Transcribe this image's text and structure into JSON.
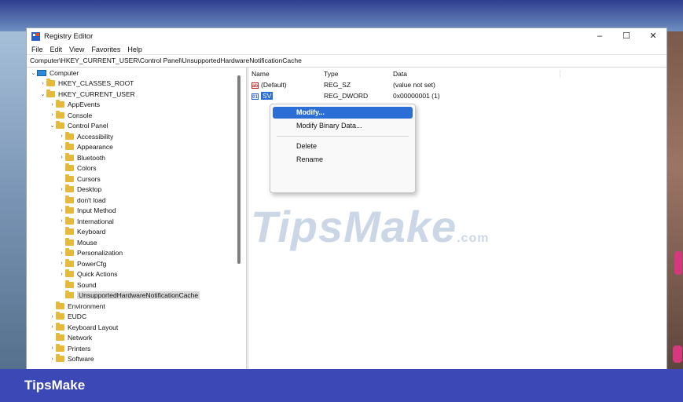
{
  "window": {
    "title": "Registry Editor",
    "controls": [
      "–",
      "☐",
      "✕"
    ]
  },
  "menu": [
    "File",
    "Edit",
    "View",
    "Favorites",
    "Help"
  ],
  "address": "Computer\\HKEY_CURRENT_USER\\Control Panel\\UnsupportedHardwareNotificationCache",
  "tree": [
    {
      "label": "Computer",
      "depth": 0,
      "chev": "⌄",
      "icon": "pc"
    },
    {
      "label": "HKEY_CLASSES_ROOT",
      "depth": 1,
      "chev": "›",
      "icon": "folder"
    },
    {
      "label": "HKEY_CURRENT_USER",
      "depth": 1,
      "chev": "⌄",
      "icon": "folder"
    },
    {
      "label": "AppEvents",
      "depth": 2,
      "chev": "›",
      "icon": "folder"
    },
    {
      "label": "Console",
      "depth": 2,
      "chev": "›",
      "icon": "folder"
    },
    {
      "label": "Control Panel",
      "depth": 2,
      "chev": "⌄",
      "icon": "folder"
    },
    {
      "label": "Accessibility",
      "depth": 3,
      "chev": "›",
      "icon": "folder"
    },
    {
      "label": "Appearance",
      "depth": 3,
      "chev": "›",
      "icon": "folder"
    },
    {
      "label": "Bluetooth",
      "depth": 3,
      "chev": "›",
      "icon": "folder"
    },
    {
      "label": "Colors",
      "depth": 3,
      "chev": "",
      "icon": "folder"
    },
    {
      "label": "Cursors",
      "depth": 3,
      "chev": "",
      "icon": "folder"
    },
    {
      "label": "Desktop",
      "depth": 3,
      "chev": "›",
      "icon": "folder"
    },
    {
      "label": "don't load",
      "depth": 3,
      "chev": "",
      "icon": "folder"
    },
    {
      "label": "Input Method",
      "depth": 3,
      "chev": "›",
      "icon": "folder"
    },
    {
      "label": "International",
      "depth": 3,
      "chev": "›",
      "icon": "folder"
    },
    {
      "label": "Keyboard",
      "depth": 3,
      "chev": "",
      "icon": "folder"
    },
    {
      "label": "Mouse",
      "depth": 3,
      "chev": "",
      "icon": "folder"
    },
    {
      "label": "Personalization",
      "depth": 3,
      "chev": "›",
      "icon": "folder"
    },
    {
      "label": "PowerCfg",
      "depth": 3,
      "chev": "›",
      "icon": "folder"
    },
    {
      "label": "Quick Actions",
      "depth": 3,
      "chev": "›",
      "icon": "folder"
    },
    {
      "label": "Sound",
      "depth": 3,
      "chev": "",
      "icon": "folder"
    },
    {
      "label": "UnsupportedHardwareNotificationCache",
      "depth": 3,
      "chev": "",
      "icon": "folder",
      "selected": true
    },
    {
      "label": "Environment",
      "depth": 2,
      "chev": "",
      "icon": "folder"
    },
    {
      "label": "EUDC",
      "depth": 2,
      "chev": "›",
      "icon": "folder"
    },
    {
      "label": "Keyboard Layout",
      "depth": 2,
      "chev": "›",
      "icon": "folder"
    },
    {
      "label": "Network",
      "depth": 2,
      "chev": "",
      "icon": "folder"
    },
    {
      "label": "Printers",
      "depth": 2,
      "chev": "›",
      "icon": "folder"
    },
    {
      "label": "Software",
      "depth": 2,
      "chev": "›",
      "icon": "folder"
    }
  ],
  "list": {
    "headers": {
      "name": "Name",
      "type": "Type",
      "data": "Data"
    },
    "rows": [
      {
        "icon": "ab",
        "name": "(Default)",
        "type": "REG_SZ",
        "data": "(value not set)"
      },
      {
        "icon": "bin",
        "name": "SV",
        "type": "REG_DWORD",
        "data": "0x00000001 (1)",
        "selected": true
      }
    ]
  },
  "context_menu": [
    {
      "label": "Modify...",
      "hover": true
    },
    {
      "label": "Modify Binary Data..."
    },
    {
      "separator": true
    },
    {
      "label": "Delete"
    },
    {
      "label": "Rename"
    }
  ],
  "watermark": {
    "main": "TipsMake",
    "suffix": ".com"
  },
  "footer": {
    "brand": "TipsMake"
  },
  "colors": {
    "accent": "#2b6fd6",
    "footer": "#3b48b6",
    "folder": "#e7b93a"
  }
}
